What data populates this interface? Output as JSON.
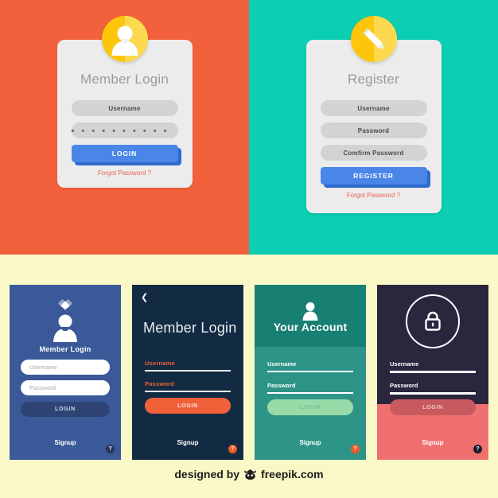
{
  "theme": {
    "page_bg": "#fbf8c8",
    "orange_panel": "#f2613c",
    "teal_panel": "#0bceb2",
    "card_bg": "#ececec",
    "field_bg": "#d3d3d3",
    "primary_button": "#4a86e8",
    "primary_button_shadow": "#2f6bce",
    "link_red": "#e8635a",
    "badge_yellow": "#fdc60b",
    "badge_yellow_light": "#fcd94f"
  },
  "top": {
    "login_panel": {
      "icon": "user-avatar-icon",
      "title": "Member Login",
      "username_value": "Username",
      "password_value": "• • • • • • • • • • •",
      "button_label": "LOGIN",
      "forgot_label": "Forgot Password ?"
    },
    "register_panel": {
      "icon": "pencil-icon",
      "title": "Register",
      "username_value": "Username",
      "password_value": "Password",
      "confirm_value": "Comfirm Password",
      "button_label": "REGISTER",
      "forgot_label": "Forgot Password ?"
    }
  },
  "bottom_cards": [
    {
      "id": "card-blue",
      "bg": "#3b5998",
      "icon": "user-avatar-icon",
      "ornament": "diamond-icon",
      "title": "Member Login",
      "username_placeholder": "Username",
      "password_placeholder": "Password",
      "button_label": "LOGIN",
      "signup_label": "Signup",
      "badge_label": "?"
    },
    {
      "id": "card-navy",
      "bg": "#132b42",
      "back_icon": "back-arrow-icon",
      "title": "Member Login",
      "username_label": "Username",
      "password_label": "Password",
      "button_label": "LOGIN",
      "signup_label": "Signup",
      "badge_label": "?"
    },
    {
      "id": "card-teal",
      "bg": "#2e9487",
      "header_bg": "#187f73",
      "icon": "user-avatar-icon",
      "title": "Your Account",
      "username_label": "Username",
      "password_label": "Password",
      "button_label": "LOGIN",
      "signup_label": "Signup",
      "badge_label": "?"
    },
    {
      "id": "card-dark-pink",
      "bg": "#f07070",
      "header_bg": "#2b253e",
      "icon": "lock-icon",
      "username_label": "Username",
      "password_label": "Password",
      "button_label": "LOGIN",
      "signup_label": "Signup",
      "badge_label": "?"
    }
  ],
  "footer": {
    "prefix": "designed by",
    "icon": "freepik-logo-icon",
    "brand": "freepik.com"
  }
}
